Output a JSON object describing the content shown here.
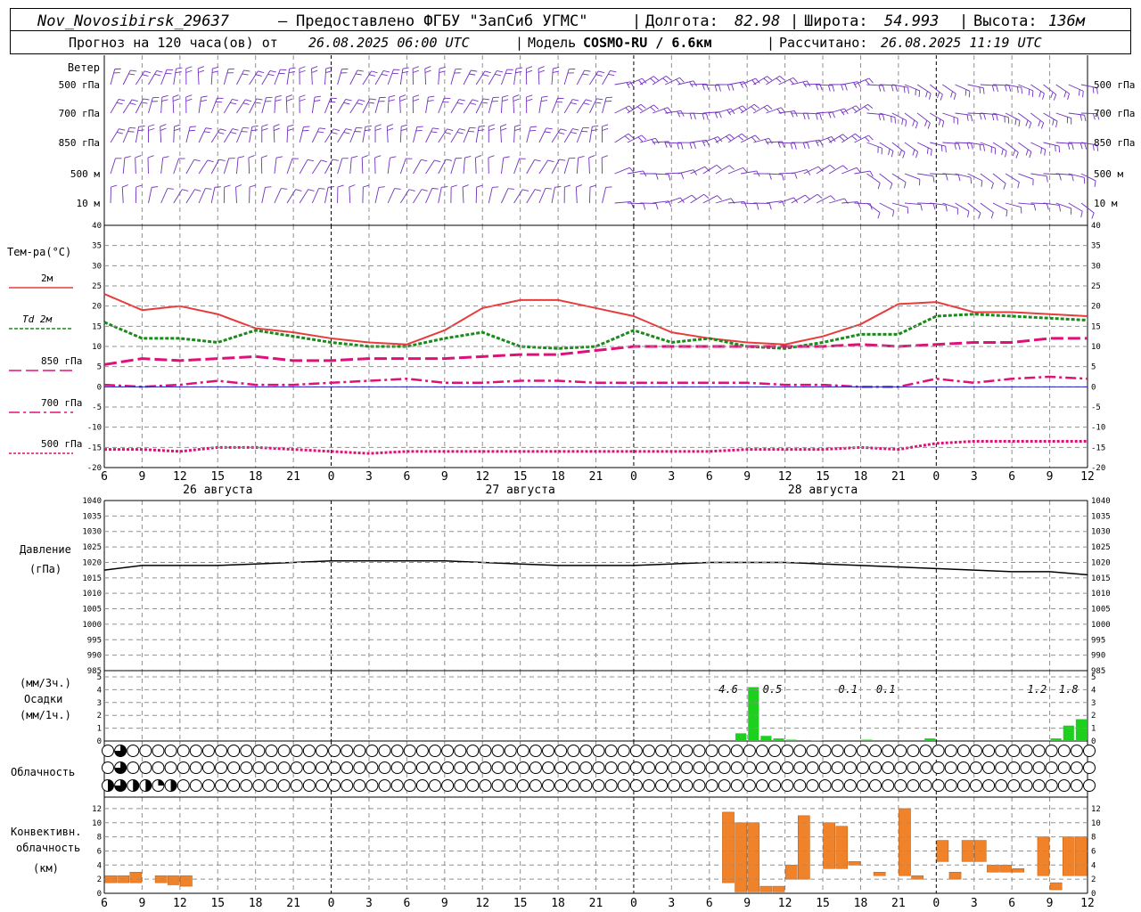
{
  "header": {
    "station": "Nov_Novosibirsk_29637",
    "dash": "–",
    "provider": "Предоставлено ФГБУ \"ЗапСиб УГМС\"",
    "lon_label": "Долгота:",
    "lon_value": "82.98",
    "lat_label": "Широта:",
    "lat_value": "54.993",
    "alt_label": "Высота:",
    "alt_value": "136м",
    "forecast_label": "Прогноз на 120 часа(ов)  от",
    "forecast_start": "26.08.2025 06:00 UTC",
    "model_label": "Модель",
    "model_name": "COSMO-RU / 6.6км",
    "computed_label": "Рассчитано:",
    "computed_value": "26.08.2025 11:19 UTC"
  },
  "colors": {
    "wind": "#7030c0",
    "t2m": "#e83c3c",
    "td2m": "#1a8a1a",
    "t850": "#e0107a",
    "t700": "#e0107a",
    "t500": "#e0107a",
    "pressure": "#000000",
    "precip": "#1ed01e",
    "convective": "#f0822a",
    "grid": "#909090",
    "zero_line": "#2020c0"
  },
  "chart_data": [
    {
      "type": "wind_barbs",
      "title": "Ветер",
      "levels": [
        "500 гПа",
        "700 гПа",
        "850 гПа",
        "500 м",
        "10  м"
      ]
    },
    {
      "type": "line",
      "title": "Тем-ра(°C)",
      "legend": [
        "2м",
        "Td  2м",
        "850 гПа",
        "700 гПа",
        "500 гПа"
      ],
      "ylim": [
        -20,
        40
      ],
      "yticks": [
        40,
        35,
        30,
        25,
        20,
        15,
        10,
        5,
        0,
        -5,
        -10,
        -15,
        -20
      ],
      "x_hours": [
        0,
        3,
        6,
        9,
        12,
        15,
        18,
        21,
        24,
        27,
        30,
        33,
        36,
        39,
        42,
        45,
        48,
        51,
        54,
        57,
        60,
        63,
        66,
        69,
        72,
        75,
        78
      ],
      "xtick_labels": [
        "6",
        "9",
        "12",
        "15",
        "18",
        "21",
        "0",
        "3",
        "6",
        "9",
        "12",
        "15",
        "18",
        "21",
        "0",
        "3",
        "6",
        "9",
        "12",
        "15",
        "18",
        "21",
        "0",
        "3",
        "6",
        "9",
        "12"
      ],
      "dates": [
        "26 августа",
        "27 августа",
        "28 августа"
      ],
      "series": [
        {
          "name": "2м",
          "values": [
            23,
            19,
            20,
            18,
            14.5,
            13.5,
            12,
            11,
            10.5,
            14,
            19.5,
            21.5,
            21.5,
            19.5,
            17.5,
            13.5,
            12,
            11,
            10.5,
            12.5,
            15.5,
            20.5,
            21,
            18.5,
            18.5,
            18,
            17.5
          ]
        },
        {
          "name": "Td  2м",
          "values": [
            16,
            12,
            12,
            11,
            14,
            12.5,
            11,
            10,
            10,
            12,
            13.5,
            10,
            9.5,
            10,
            14,
            11,
            12,
            10,
            9.5,
            11,
            13,
            13,
            17.5,
            18,
            17.5,
            17,
            16.5
          ]
        },
        {
          "name": "850 гПа",
          "values": [
            5.5,
            7,
            6.5,
            7,
            7.5,
            6.5,
            6.5,
            7,
            7,
            7,
            7.5,
            8,
            8,
            9,
            10,
            10,
            10,
            10,
            10,
            10,
            10.5,
            10,
            10.5,
            11,
            11,
            12,
            12
          ]
        },
        {
          "name": "700 гПа",
          "values": [
            0.5,
            0,
            0.5,
            1.5,
            0.5,
            0.5,
            1,
            1.5,
            2,
            1,
            1,
            1.5,
            1.5,
            1,
            1,
            1,
            1,
            1,
            0.5,
            0.5,
            0,
            0,
            2,
            1,
            2,
            2.5,
            2
          ]
        },
        {
          "name": "500 гПа",
          "values": [
            -15.5,
            -15.5,
            -16,
            -15,
            -15,
            -15.5,
            -16,
            -16.5,
            -16,
            -16,
            -16,
            -16,
            -16,
            -16,
            -16,
            -16,
            -16,
            -15.5,
            -15.5,
            -15.5,
            -15,
            -15.5,
            -14,
            -13.5,
            -13.5,
            -13.5,
            -13.5
          ]
        }
      ]
    },
    {
      "type": "line",
      "title": "Давление",
      "ylabel": "(гПа)",
      "ylim": [
        985,
        1040
      ],
      "yticks": [
        1040,
        1035,
        1030,
        1025,
        1020,
        1015,
        1010,
        1005,
        1000,
        995,
        990,
        985
      ],
      "x_hours": [
        0,
        3,
        6,
        9,
        12,
        15,
        18,
        21,
        24,
        27,
        30,
        33,
        36,
        39,
        42,
        45,
        48,
        51,
        54,
        57,
        60,
        63,
        66,
        69,
        72,
        75,
        78
      ],
      "series": [
        {
          "name": "Давление",
          "values": [
            1017.5,
            1019,
            1019,
            1019,
            1019.5,
            1020,
            1020.5,
            1020.5,
            1020.5,
            1020.5,
            1020,
            1019.5,
            1019,
            1019,
            1019,
            1019.5,
            1020,
            1020,
            1020,
            1019.5,
            1019,
            1018.5,
            1018,
            1017.5,
            1017,
            1017,
            1016
          ]
        }
      ]
    },
    {
      "type": "bar",
      "title": "Осадки",
      "ylabel_top": "(мм/3ч.)",
      "ylabel_bottom": "(мм/1ч.)",
      "ylim": [
        0,
        5
      ],
      "yticks": [
        5,
        4,
        3,
        2,
        1,
        0
      ],
      "x_hours": [
        50,
        51,
        52,
        53,
        54,
        56,
        60,
        65,
        75,
        76,
        77
      ],
      "values": [
        0.6,
        4.2,
        0.4,
        0.2,
        0.1,
        0.05,
        0.1,
        0.2,
        0.2,
        1.2,
        1.7
      ],
      "annotations": [
        {
          "hour": 49.5,
          "label": "4.6"
        },
        {
          "hour": 53,
          "label": "0.5"
        },
        {
          "hour": 59,
          "label": "0.1"
        },
        {
          "hour": 62,
          "label": "0.1"
        },
        {
          "hour": 74,
          "label": "1.2"
        },
        {
          "hour": 76.5,
          "label": "1.8"
        }
      ]
    },
    {
      "type": "cloud_symbols",
      "title": "Облачность",
      "rows": [
        {
          "level": "upper",
          "values": [
            0,
            0.75,
            0,
            0,
            0,
            0,
            0,
            0,
            0,
            0,
            0,
            0,
            0,
            0,
            0,
            0,
            0,
            0,
            0,
            0,
            0,
            0,
            0,
            0,
            0,
            0,
            0,
            0,
            0,
            0,
            0,
            0,
            0,
            0,
            0,
            0,
            0,
            0,
            0,
            0,
            0,
            0,
            0,
            0,
            0,
            0,
            0,
            0,
            0,
            0,
            0,
            0,
            0,
            0,
            0,
            0,
            0,
            0,
            0,
            0,
            0,
            0,
            0,
            0,
            0,
            0,
            0,
            0,
            0,
            0,
            0,
            0,
            0,
            0,
            0,
            0,
            0,
            0,
            0
          ]
        },
        {
          "level": "middle",
          "values": [
            0,
            0.75,
            0,
            0,
            0,
            0,
            0,
            0,
            0,
            0,
            0,
            0,
            0,
            0,
            0,
            0,
            0,
            0,
            0,
            0,
            0,
            0,
            0,
            0,
            0,
            0,
            0,
            0,
            0,
            0,
            0,
            0,
            0,
            0,
            0,
            0,
            0,
            0,
            0,
            0,
            0,
            0,
            0,
            0,
            0,
            0,
            0,
            0,
            0,
            0,
            0,
            0,
            0,
            0,
            0,
            0,
            0,
            0,
            0,
            0,
            0,
            0,
            0,
            0,
            0,
            0,
            0,
            0,
            0,
            0,
            0,
            0,
            0,
            0,
            0,
            0,
            0,
            0,
            0
          ]
        },
        {
          "level": "lower",
          "values": [
            0.5,
            0.75,
            0.5,
            0.5,
            0.25,
            0.5,
            0,
            0,
            0,
            0,
            0,
            0,
            0,
            0,
            0,
            0,
            0,
            0,
            0,
            0,
            0,
            0,
            0,
            0,
            0,
            0,
            0,
            0,
            0,
            0,
            0,
            0,
            0,
            0,
            0,
            0,
            0,
            0,
            0,
            0,
            0,
            0,
            0,
            0,
            0,
            0,
            0,
            0,
            0,
            0,
            0,
            0,
            0,
            0,
            0,
            0,
            0,
            0,
            0,
            0,
            0,
            0,
            0,
            0,
            0,
            0,
            0,
            0,
            0,
            0,
            0,
            0,
            0,
            0,
            0,
            0,
            0,
            0,
            0
          ]
        }
      ]
    },
    {
      "type": "bar",
      "title": "Конвективн.",
      "subtitle": "облачность",
      "ylabel": "(км)",
      "ylim": [
        0,
        13
      ],
      "yticks": [
        12,
        10,
        8,
        6,
        4,
        2,
        0
      ],
      "bars": [
        {
          "hour": 0.5,
          "base": 1.5,
          "top": 2.5
        },
        {
          "hour": 1.5,
          "base": 1.5,
          "top": 2.5
        },
        {
          "hour": 2.5,
          "base": 1.5,
          "top": 3
        },
        {
          "hour": 4.5,
          "base": 1.5,
          "top": 2.5
        },
        {
          "hour": 5.5,
          "base": 1.2,
          "top": 2.5
        },
        {
          "hour": 6.5,
          "base": 1.0,
          "top": 2.5
        },
        {
          "hour": 49.5,
          "base": 1.5,
          "top": 11.5
        },
        {
          "hour": 50.5,
          "base": 0.2,
          "top": 10
        },
        {
          "hour": 51.5,
          "base": 0.2,
          "top": 10
        },
        {
          "hour": 52.5,
          "base": 0.2,
          "top": 1
        },
        {
          "hour": 53.5,
          "base": 0.2,
          "top": 1
        },
        {
          "hour": 54.5,
          "base": 2,
          "top": 4
        },
        {
          "hour": 55.5,
          "base": 2,
          "top": 11
        },
        {
          "hour": 57.5,
          "base": 3.5,
          "top": 10
        },
        {
          "hour": 58.5,
          "base": 3.5,
          "top": 9.5
        },
        {
          "hour": 59.5,
          "base": 4,
          "top": 4.5
        },
        {
          "hour": 61.5,
          "base": 2.5,
          "top": 3
        },
        {
          "hour": 63.5,
          "base": 2.5,
          "top": 12
        },
        {
          "hour": 64.5,
          "base": 2,
          "top": 2.5
        },
        {
          "hour": 66.5,
          "base": 4.5,
          "top": 7.5
        },
        {
          "hour": 67.5,
          "base": 2,
          "top": 3
        },
        {
          "hour": 68.5,
          "base": 4.5,
          "top": 7.5
        },
        {
          "hour": 69.5,
          "base": 4.5,
          "top": 7.5
        },
        {
          "hour": 70.5,
          "base": 3,
          "top": 4
        },
        {
          "hour": 71.5,
          "base": 3,
          "top": 4
        },
        {
          "hour": 72.5,
          "base": 3,
          "top": 3.5
        },
        {
          "hour": 74.5,
          "base": 2.5,
          "top": 8
        },
        {
          "hour": 75.5,
          "base": 0.5,
          "top": 1.5
        },
        {
          "hour": 76.5,
          "base": 2.5,
          "top": 8
        },
        {
          "hour": 77.5,
          "base": 2.5,
          "top": 8
        }
      ]
    }
  ]
}
